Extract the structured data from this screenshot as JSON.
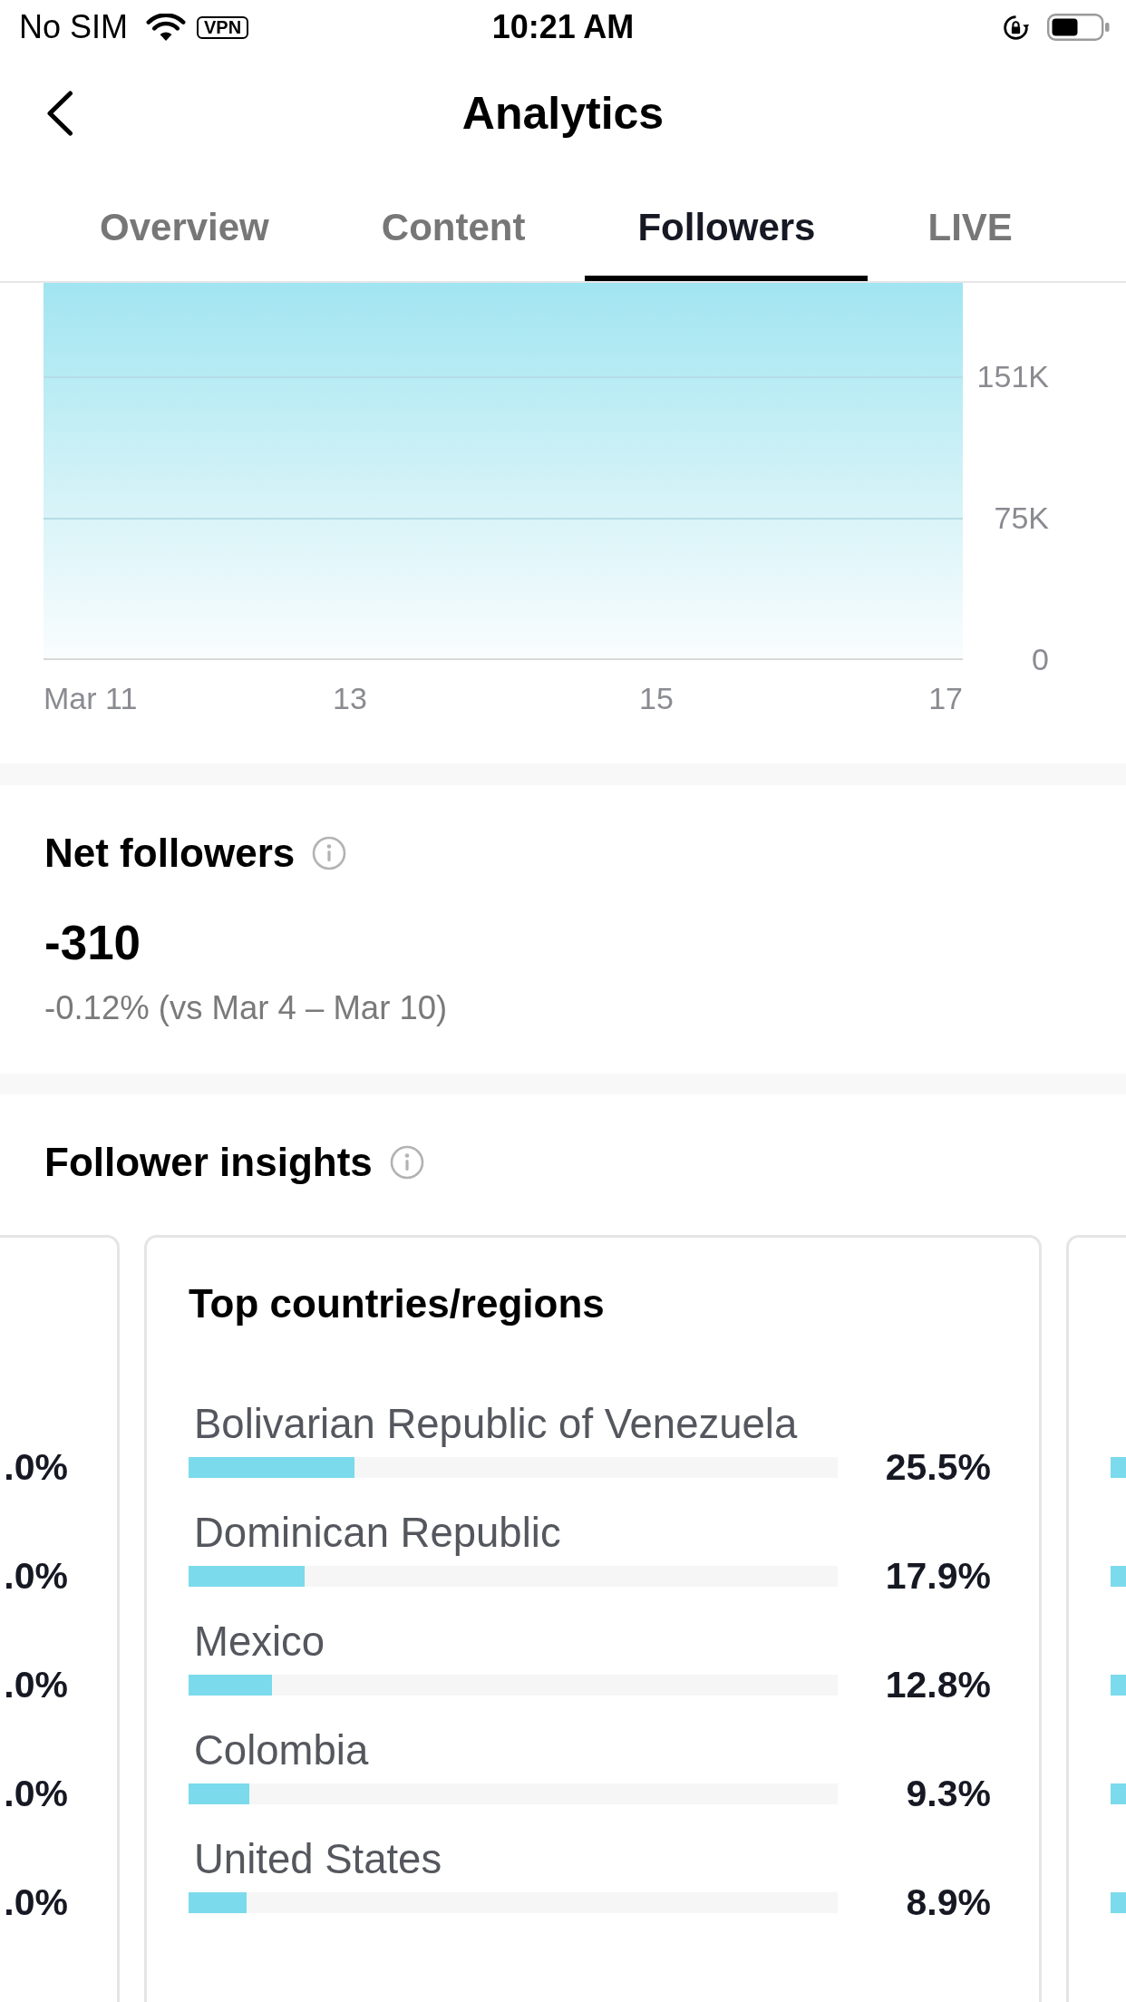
{
  "status_bar": {
    "carrier": "No SIM",
    "vpn": "VPN",
    "time": "10:21 AM"
  },
  "header": {
    "title": "Analytics"
  },
  "tabs": [
    {
      "label": "Overview",
      "selected": false
    },
    {
      "label": "Content",
      "selected": false
    },
    {
      "label": "Followers",
      "selected": true
    },
    {
      "label": "LIVE",
      "selected": false
    }
  ],
  "chart": {
    "y_labels": [
      "151K",
      "75K",
      "0"
    ],
    "x_labels": [
      "Mar 11",
      "13",
      "15",
      "17"
    ]
  },
  "net_followers": {
    "title": "Net followers",
    "value": "-310",
    "comparison": "-0.12% (vs Mar 4 – Mar 10)"
  },
  "follower_insights": {
    "title": "Follower insights",
    "cards": [
      {
        "kind": "clipped_left",
        "rows": [
          {
            "percent": ".0%"
          },
          {
            "percent": ".0%"
          },
          {
            "percent": ".0%"
          },
          {
            "percent": ".0%"
          },
          {
            "percent": ".0%"
          }
        ]
      },
      {
        "kind": "full",
        "title": "Top countries/regions",
        "rows": [
          {
            "label": "Bolivarian Republic of Venezuela",
            "level": 0.255,
            "percent": "25.5%"
          },
          {
            "label": "Dominican Republic",
            "level": 0.179,
            "percent": "17.9%"
          },
          {
            "label": "Mexico",
            "level": 0.128,
            "percent": "12.8%"
          },
          {
            "label": "Colombia",
            "level": 0.093,
            "percent": "9.3%"
          },
          {
            "label": "United States",
            "level": 0.089,
            "percent": "8.9%"
          }
        ]
      },
      {
        "kind": "clipped_right",
        "rows": [
          {
            "filled": true
          },
          {
            "filled": true
          },
          {
            "filled": true
          },
          {
            "filled": true
          },
          {
            "filled": true
          }
        ]
      }
    ]
  }
}
